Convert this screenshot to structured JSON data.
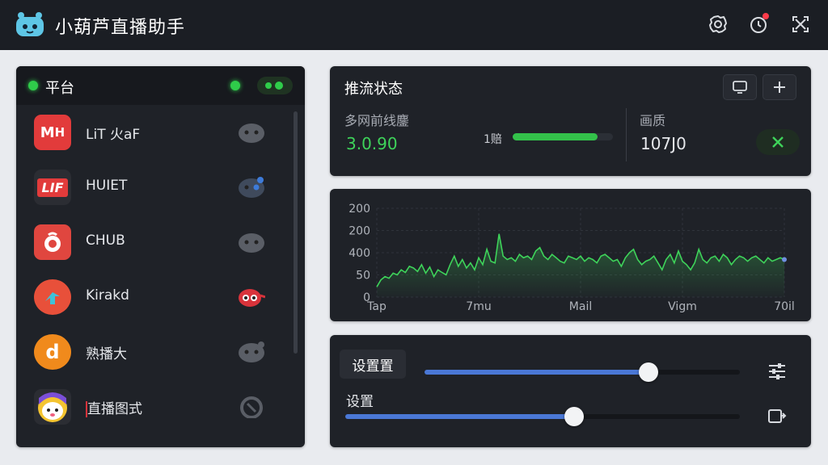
{
  "app": {
    "title": "小葫芦直播助手"
  },
  "sidebar": {
    "title": "平台",
    "items": [
      {
        "name": "LiT 火aF",
        "icon_text": "M H",
        "icon_color": "#e23b3b",
        "status_icon": "face-icon",
        "status_color": "#5a5e66"
      },
      {
        "name": "HUIET",
        "icon_text": "LIF",
        "icon_color": "#2b2d33",
        "status_icon": "face-icon",
        "status_color": "#4d6fa8"
      },
      {
        "name": "CHUB",
        "icon_text": "",
        "icon_color": "#e0463f",
        "status_icon": "face-icon",
        "status_color": "#5a5e66"
      },
      {
        "name": "Kirakd",
        "icon_text": "",
        "icon_color": "#e8503a",
        "status_icon": "face-icon",
        "status_color": "#d8333b"
      },
      {
        "name": "熟播大",
        "icon_text": "d",
        "icon_color": "#f08a1c",
        "status_icon": "face-icon",
        "status_color": "#5a5e66"
      },
      {
        "name": "直播图式",
        "icon_text": "",
        "icon_color": "#f4c430",
        "status_icon": "face-icon",
        "status_color": "#5a5e66"
      }
    ]
  },
  "status": {
    "title": "推流状态",
    "multi_label": "多网前线鏖",
    "multi_value": "3.0.90",
    "progress_label": "1赔",
    "progress": 0.85,
    "quality_label": "画质",
    "quality_value": "107J0"
  },
  "chart_data": {
    "type": "line",
    "y_tick_labels": [
      "200",
      "200",
      "400",
      "50",
      "0"
    ],
    "x_tick_labels": [
      "Tap",
      "7mu",
      "Mail",
      "Vigm",
      "70il"
    ],
    "color": "#3ed35a",
    "x": [
      0,
      1,
      2,
      3,
      4,
      5,
      6,
      7,
      8,
      9,
      10,
      11,
      12,
      13,
      14,
      15,
      16,
      17,
      18,
      19,
      20,
      21,
      22,
      23,
      24,
      25,
      26,
      27,
      28,
      29,
      30,
      31,
      32,
      33,
      34,
      35,
      36,
      37,
      38,
      39,
      40,
      41,
      42,
      43,
      44,
      45,
      46,
      47,
      48,
      49,
      50,
      51,
      52,
      53,
      54,
      55,
      56,
      57,
      58,
      59,
      60,
      61,
      62,
      63,
      64,
      65,
      66,
      67,
      68,
      69,
      70,
      71,
      72,
      73,
      74,
      75,
      76,
      77,
      78,
      79,
      80,
      81,
      82,
      83,
      84,
      85,
      86,
      87,
      88,
      89,
      90,
      91,
      92,
      93,
      94,
      95,
      96,
      97,
      98,
      99,
      100
    ],
    "y": [
      30,
      50,
      60,
      55,
      70,
      65,
      80,
      72,
      90,
      85,
      75,
      95,
      70,
      88,
      60,
      80,
      72,
      65,
      95,
      120,
      90,
      110,
      85,
      100,
      80,
      115,
      95,
      140,
      105,
      100,
      185,
      120,
      110,
      115,
      105,
      125,
      115,
      120,
      110,
      135,
      145,
      120,
      110,
      125,
      115,
      105,
      100,
      120,
      115,
      110,
      120,
      105,
      115,
      110,
      100,
      120,
      125,
      115,
      105,
      110,
      90,
      115,
      130,
      140,
      110,
      95,
      105,
      110,
      120,
      100,
      80,
      110,
      125,
      100,
      135,
      105,
      95,
      80,
      100,
      140,
      110,
      100,
      115,
      120,
      105,
      125,
      115,
      95,
      110,
      120,
      115,
      105,
      115,
      120,
      110,
      100,
      115,
      105,
      110,
      115,
      110
    ],
    "ylim": [
      0,
      260
    ]
  },
  "settings": {
    "button_label": "设置置",
    "label": "设置",
    "slider1": 0.71,
    "slider2": 0.58
  }
}
